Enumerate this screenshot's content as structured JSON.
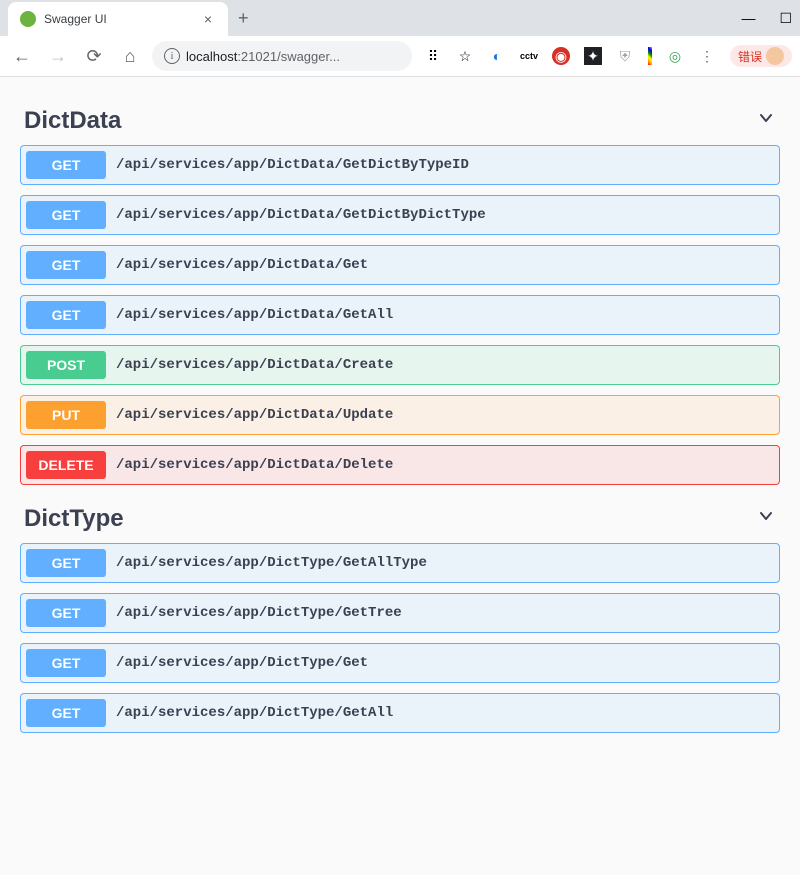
{
  "browser": {
    "tab_title": "Swagger UI",
    "url_host": "localhost",
    "url_port": ":21021",
    "url_path": "/swagger...",
    "error_label": "错误"
  },
  "sections": [
    {
      "name": "DictData",
      "endpoints": [
        {
          "method": "GET",
          "method_class": "get",
          "path": "/api/services/app/DictData/GetDictByTypeID"
        },
        {
          "method": "GET",
          "method_class": "get",
          "path": "/api/services/app/DictData/GetDictByDictType"
        },
        {
          "method": "GET",
          "method_class": "get",
          "path": "/api/services/app/DictData/Get"
        },
        {
          "method": "GET",
          "method_class": "get",
          "path": "/api/services/app/DictData/GetAll"
        },
        {
          "method": "POST",
          "method_class": "post",
          "path": "/api/services/app/DictData/Create"
        },
        {
          "method": "PUT",
          "method_class": "put",
          "path": "/api/services/app/DictData/Update"
        },
        {
          "method": "DELETE",
          "method_class": "delete",
          "path": "/api/services/app/DictData/Delete"
        }
      ]
    },
    {
      "name": "DictType",
      "endpoints": [
        {
          "method": "GET",
          "method_class": "get",
          "path": "/api/services/app/DictType/GetAllType"
        },
        {
          "method": "GET",
          "method_class": "get",
          "path": "/api/services/app/DictType/GetTree"
        },
        {
          "method": "GET",
          "method_class": "get",
          "path": "/api/services/app/DictType/Get"
        },
        {
          "method": "GET",
          "method_class": "get",
          "path": "/api/services/app/DictType/GetAll"
        }
      ]
    }
  ]
}
